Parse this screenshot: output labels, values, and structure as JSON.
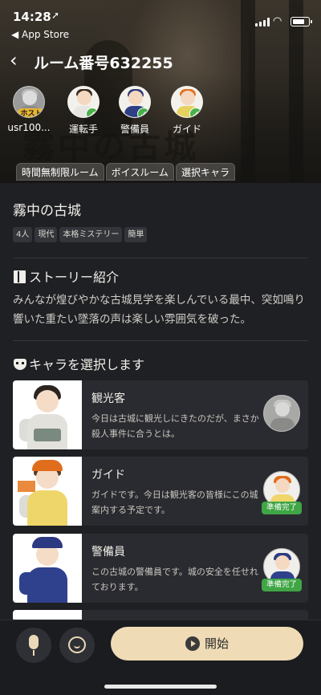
{
  "status_bar": {
    "time": "14:28",
    "back_app": "◀ App Store"
  },
  "nav": {
    "title": "ルーム番号632255"
  },
  "players": [
    {
      "name": "usr100...",
      "badge": "ホスト"
    },
    {
      "name": "運転手"
    },
    {
      "name": "警備員"
    },
    {
      "name": "ガイド"
    }
  ],
  "hero": {
    "art_title": "霧中の古城"
  },
  "room_tags": [
    "時間無制限ルーム",
    "ボイスルーム",
    "選択キャラ"
  ],
  "game": {
    "title": "霧中の古城",
    "tags": [
      "4人",
      "現代",
      "本格ミステリー",
      "簡単"
    ]
  },
  "story": {
    "heading": "ストーリー紹介",
    "text": "みんなが煌びやかな古城見学を楽しんでいる最中、突如鳴り響いた重たい墜落の声は楽しい雰囲気を破った。"
  },
  "characters": {
    "heading": "キャラを選択します",
    "list": [
      {
        "name": "観光客",
        "desc": "今日は古城に観光しにきたのだが、まさか殺人事件に合うとは。",
        "status": ""
      },
      {
        "name": "ガイド",
        "desc": "ガイドです。今日は観光客の皆様にこの城案内する予定です。",
        "status": "準備完了"
      },
      {
        "name": "警備員",
        "desc": "この古城の警備員です。城の安全を任せれております。",
        "status": "準備完了"
      }
    ]
  },
  "bottom": {
    "start_label": "開始"
  }
}
